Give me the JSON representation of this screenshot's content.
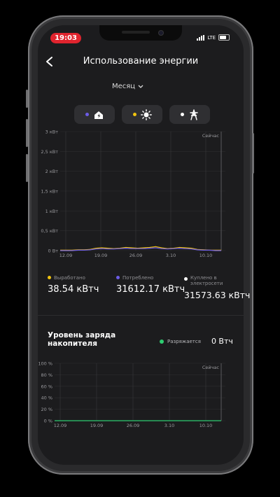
{
  "status": {
    "time": "19:03",
    "network": "LTE"
  },
  "header": {
    "title": "Использование энергии",
    "period": "Месяц"
  },
  "filters": [
    {
      "name": "consumed",
      "dot_color": "#6c5ce7",
      "icon": "house-lightning-icon"
    },
    {
      "name": "produced",
      "dot_color": "#f1c40f",
      "icon": "sun-icon"
    },
    {
      "name": "grid",
      "dot_color": "#ffffff",
      "icon": "power-tower-icon"
    }
  ],
  "chart_data": [
    {
      "type": "line",
      "title": "",
      "marker_label": "Сейчас",
      "x_ticks": [
        "12.09",
        "19.09",
        "26.09",
        "3.10",
        "10.10"
      ],
      "y_ticks": [
        "0 Вт",
        "0,5 кВт",
        "1 кВт",
        "1,5 кВт",
        "2 кВт",
        "2,5 кВт",
        "3 кВт"
      ],
      "ylim": [
        0,
        3
      ],
      "yunit": "кВт",
      "grid": true,
      "series": [
        {
          "name": "Выработано",
          "color": "#f1c40f",
          "values": [
            0.01,
            0.01,
            0.01,
            0.02,
            0.02,
            0.03,
            0.06,
            0.07,
            0.06,
            0.05,
            0.06,
            0.08,
            0.07,
            0.06,
            0.07,
            0.08,
            0.1,
            0.07,
            0.05,
            0.06,
            0.08,
            0.07,
            0.06,
            0.03,
            0.02,
            0.01,
            0.01,
            0.01
          ]
        },
        {
          "name": "Потреблено",
          "color": "#6c5ce7",
          "values": [
            0,
            0,
            0,
            0.01,
            0.01,
            0.02,
            0.04,
            0.05,
            0.04,
            0.04,
            0.05,
            0.06,
            0.05,
            0.05,
            0.05,
            0.06,
            0.07,
            0.05,
            0.04,
            0.05,
            0.06,
            0.05,
            0.04,
            0.02,
            0.01,
            0.01,
            0,
            0
          ]
        }
      ]
    },
    {
      "type": "area",
      "title": "",
      "marker_label": "Сейчас",
      "x_ticks": [
        "12.09",
        "19.09",
        "26.09",
        "3.10",
        "10.10"
      ],
      "y_ticks": [
        "0 %",
        "20 %",
        "40 %",
        "60 %",
        "80 %",
        "100 %"
      ],
      "ylim": [
        0,
        100
      ],
      "yunit": "%",
      "grid": true,
      "series": [
        {
          "name": "Уровень заряда",
          "color": "#2ecc71",
          "values": [
            0,
            0,
            0,
            0,
            0,
            0,
            0,
            0,
            0,
            0,
            0,
            0,
            0,
            0,
            0,
            0,
            0,
            0,
            0,
            0,
            0,
            0,
            0,
            0,
            0,
            0,
            0,
            0
          ]
        }
      ]
    }
  ],
  "stats": [
    {
      "label": "Выработано",
      "value": "38.54 кВтч",
      "dot_color": "#f1c40f"
    },
    {
      "label": "Потреблено",
      "value": "31612.17 кВтч",
      "dot_color": "#6c5ce7"
    },
    {
      "label": "Куплено в электросети",
      "value": "31573.63 кВтч",
      "dot_color": "#ffffff"
    }
  ],
  "battery": {
    "title": "Уровень заряда накопителя",
    "status_label": "Разряжается",
    "status_color": "#2ecc71",
    "value": "0 Втч"
  }
}
